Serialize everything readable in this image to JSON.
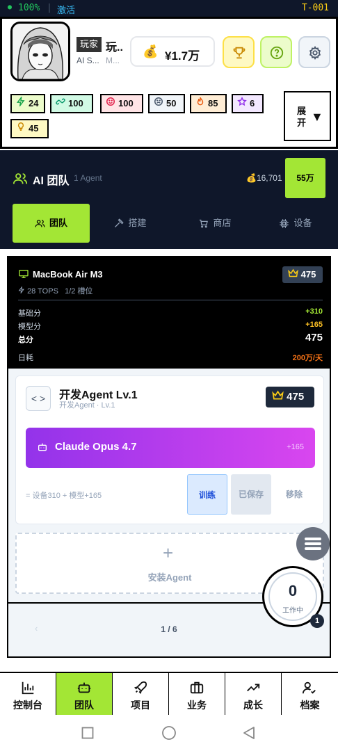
{
  "status_bar": {
    "dot": "●",
    "battery": "100%",
    "separator": "|",
    "activate": "激活",
    "code": "T-001"
  },
  "player": {
    "tag": "玩家",
    "name": "玩..",
    "sub1": "AI S...",
    "sub2": "M...",
    "money": "¥1.7万",
    "money_icon": "💰"
  },
  "stats": [
    {
      "icon": "bolt-icon",
      "value": "24",
      "bg": "#ecfccb"
    },
    {
      "icon": "link-icon",
      "value": "100",
      "bg": "#d1fae5"
    },
    {
      "icon": "smile-icon",
      "value": "100",
      "bg": "#ffe4e6"
    },
    {
      "icon": "frown-icon",
      "value": "50",
      "bg": "#f1f5f9"
    },
    {
      "icon": "flame-icon",
      "value": "85",
      "bg": "#ffedd5"
    },
    {
      "icon": "star-icon",
      "value": "6",
      "bg": "#f3e8ff"
    },
    {
      "icon": "bulb-icon",
      "value": "45",
      "bg": "#fef9c3"
    }
  ],
  "expand_label": "展开",
  "expand_arrow": "▼",
  "team": {
    "title": "AI 团队",
    "subtitle": "1 Agent",
    "coins": "💰16,701",
    "button": "55万"
  },
  "tabs": [
    {
      "label": "团队"
    },
    {
      "label": "搭建"
    },
    {
      "label": "商店"
    },
    {
      "label": "设备"
    }
  ],
  "device": {
    "name": "MacBook Air M3",
    "score": "475",
    "tops": "28 TOPS",
    "slots": "1/2 槽位",
    "rows": [
      {
        "label": "基础分",
        "value": "+310",
        "color": "#a3e635"
      },
      {
        "label": "模型分",
        "value": "+165",
        "color": "#fbbf24"
      },
      {
        "label": "总分",
        "value": "475",
        "color": "#ffffff"
      },
      {
        "label": "日耗",
        "value": "200万/天",
        "color": "#f97316"
      }
    ]
  },
  "agent": {
    "code_glyph": "< >",
    "name": "开发Agent Lv.1",
    "sub": "开发Agent · Lv.1",
    "score": "475",
    "model": "Claude Opus 4.7",
    "model_plus": "+165",
    "formula": "= 设备310 + 模型+165",
    "train": "训练",
    "saved": "已保存",
    "remove": "移除"
  },
  "install": {
    "plus": "+",
    "label": "安装Agent"
  },
  "pager": {
    "prev": "‹",
    "page": "1 / 6"
  },
  "work": {
    "count": "0",
    "label": "工作中",
    "badge": "1"
  },
  "nav": [
    {
      "label": "控制台"
    },
    {
      "label": "团队"
    },
    {
      "label": "项目"
    },
    {
      "label": "业务"
    },
    {
      "label": "成长"
    },
    {
      "label": "档案"
    }
  ]
}
